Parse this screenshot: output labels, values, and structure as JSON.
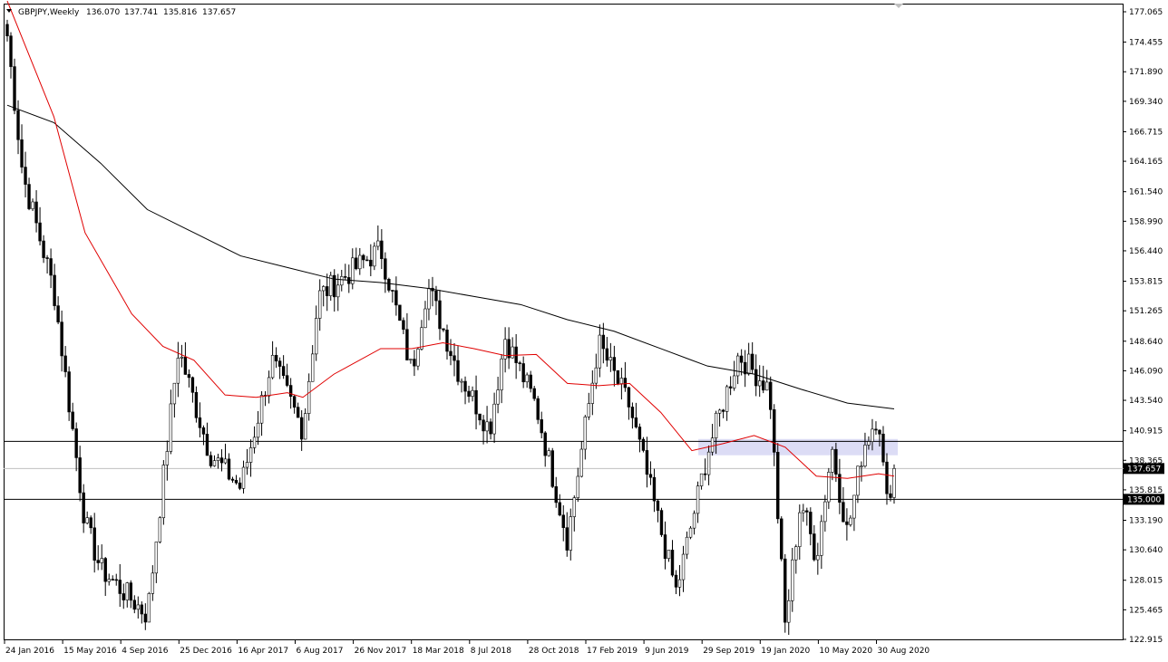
{
  "header": {
    "symbol": "GBPJPY,Weekly",
    "open": "136.070",
    "high": "137.741",
    "low": "135.816",
    "close": "137.657"
  },
  "price_axis": {
    "ticks": [
      "177.065",
      "174.455",
      "171.890",
      "169.340",
      "166.715",
      "164.165",
      "161.540",
      "158.990",
      "156.440",
      "153.815",
      "151.265",
      "148.640",
      "146.090",
      "143.540",
      "140.915",
      "138.365",
      "135.815",
      "133.190",
      "130.640",
      "128.015",
      "125.465",
      "122.915"
    ],
    "current_price_label": "137.657",
    "level_label": "135.000"
  },
  "time_axis": {
    "labels": [
      "24 Jan 2016",
      "15 May 2016",
      "4 Sep 2016",
      "25 Dec 2016",
      "16 Apr 2017",
      "6 Aug 2017",
      "26 Nov 2017",
      "18 Mar 2018",
      "8 Jul 2018",
      "28 Oct 2018",
      "17 Feb 2019",
      "9 Jun 2019",
      "29 Sep 2019",
      "19 Jan 2020",
      "10 May 2020",
      "30 Aug 2020"
    ]
  },
  "colors": {
    "background": "#ffffff",
    "axis": "#000000",
    "bull_candle": "#ffffff",
    "bear_candle": "#000000",
    "ma_fast": "#e00000",
    "ma_slow": "#000000",
    "zone": "#dcdcf5"
  },
  "chart_data": {
    "type": "candlestick",
    "instrument": "GBPJPY",
    "timeframe": "Weekly",
    "ylim": [
      122.915,
      177.065
    ],
    "x_range": [
      "24 Jan 2016",
      "Oct 2020"
    ],
    "grid": false,
    "horizontal_levels": [
      140.0,
      137.657,
      135.0
    ],
    "resistance_zone": [
      138.8,
      140.2
    ],
    "key_points": [
      {
        "date": "Jan 2016",
        "price": 175.0
      },
      {
        "date": "Feb 2016",
        "price": 163.0
      },
      {
        "date": "Apr 2016",
        "price": 153.0
      },
      {
        "date": "Jun 2016",
        "price": 133.0
      },
      {
        "date": "Jul 2016",
        "price": 129.0
      },
      {
        "date": "Oct 2016",
        "price": 125.0
      },
      {
        "date": "Dec 2016",
        "price": 148.0
      },
      {
        "date": "Feb 2017",
        "price": 139.0
      },
      {
        "date": "Apr 2017",
        "price": 136.0
      },
      {
        "date": "Jun 2017",
        "price": 147.0
      },
      {
        "date": "Aug 2017",
        "price": 141.0
      },
      {
        "date": "Sep 2017",
        "price": 152.5
      },
      {
        "date": "Jan 2018",
        "price": 156.6
      },
      {
        "date": "Mar 2018",
        "price": 146.0
      },
      {
        "date": "Apr 2018",
        "price": 153.5
      },
      {
        "date": "Jun 2018",
        "price": 146.0
      },
      {
        "date": "Aug 2018",
        "price": 141.0
      },
      {
        "date": "Sep 2018",
        "price": 149.0
      },
      {
        "date": "Nov 2018",
        "price": 143.0
      },
      {
        "date": "Jan 2019",
        "price": 131.5
      },
      {
        "date": "Mar 2019",
        "price": 148.5
      },
      {
        "date": "May 2019",
        "price": 143.0
      },
      {
        "date": "Aug 2019",
        "price": 127.0
      },
      {
        "date": "Oct 2019",
        "price": 139.0
      },
      {
        "date": "Dec 2019",
        "price": 147.5
      },
      {
        "date": "Feb 2020",
        "price": 144.5
      },
      {
        "date": "Mar 2020",
        "price": 124.0
      },
      {
        "date": "Apr 2020",
        "price": 135.0
      },
      {
        "date": "May 2020",
        "price": 130.0
      },
      {
        "date": "Jun 2020",
        "price": 139.5
      },
      {
        "date": "Jul 2020",
        "price": 132.0
      },
      {
        "date": "Aug 2020",
        "price": 139.5
      },
      {
        "date": "Sep 2020",
        "price": 142.5
      },
      {
        "date": "Sep 2020",
        "price": 134.5
      },
      {
        "date": "Oct 2020",
        "price": 137.657
      }
    ],
    "ma_fast": [
      {
        "date": "Jan 2016",
        "value": 178.0
      },
      {
        "date": "Apr 2016",
        "value": 168.0
      },
      {
        "date": "Jun 2016",
        "value": 158.0
      },
      {
        "date": "Sep 2016",
        "value": 151.0
      },
      {
        "date": "Nov 2016",
        "value": 148.2
      },
      {
        "date": "Jan 2017",
        "value": 147.0
      },
      {
        "date": "Mar 2017",
        "value": 144.0
      },
      {
        "date": "May 2017",
        "value": 143.8
      },
      {
        "date": "Jul 2017",
        "value": 144.2
      },
      {
        "date": "Aug 2017",
        "value": 143.8
      },
      {
        "date": "Oct 2017",
        "value": 145.8
      },
      {
        "date": "Jan 2018",
        "value": 148.0
      },
      {
        "date": "Mar 2018",
        "value": 148.0
      },
      {
        "date": "May 2018",
        "value": 148.5
      },
      {
        "date": "Jul 2018",
        "value": 148.0
      },
      {
        "date": "Sep 2018",
        "value": 147.4
      },
      {
        "date": "Nov 2018",
        "value": 147.5
      },
      {
        "date": "Jan 2019",
        "value": 145.0
      },
      {
        "date": "Mar 2019",
        "value": 144.8
      },
      {
        "date": "May 2019",
        "value": 145.0
      },
      {
        "date": "Jul 2019",
        "value": 142.5
      },
      {
        "date": "Sep 2019",
        "value": 139.2
      },
      {
        "date": "Nov 2019",
        "value": 139.8
      },
      {
        "date": "Jan 2020",
        "value": 140.5
      },
      {
        "date": "Mar 2020",
        "value": 139.5
      },
      {
        "date": "May 2020",
        "value": 137.0
      },
      {
        "date": "Jul 2020",
        "value": 136.8
      },
      {
        "date": "Sep 2020",
        "value": 137.2
      },
      {
        "date": "Oct 2020",
        "value": 137.0
      }
    ],
    "ma_slow": [
      {
        "date": "Jan 2016",
        "value": 169.0
      },
      {
        "date": "Apr 2016",
        "value": 167.5
      },
      {
        "date": "Jul 2016",
        "value": 164.0
      },
      {
        "date": "Oct 2016",
        "value": 160.0
      },
      {
        "date": "Jan 2017",
        "value": 158.0
      },
      {
        "date": "Apr 2017",
        "value": 156.0
      },
      {
        "date": "Jul 2017",
        "value": 155.0
      },
      {
        "date": "Oct 2017",
        "value": 154.0
      },
      {
        "date": "Jan 2018",
        "value": 153.7
      },
      {
        "date": "Apr 2018",
        "value": 153.2
      },
      {
        "date": "Jul 2018",
        "value": 152.5
      },
      {
        "date": "Oct 2018",
        "value": 151.8
      },
      {
        "date": "Jan 2019",
        "value": 150.5
      },
      {
        "date": "Apr 2019",
        "value": 149.5
      },
      {
        "date": "Jul 2019",
        "value": 148.0
      },
      {
        "date": "Oct 2019",
        "value": 146.5
      },
      {
        "date": "Jan 2020",
        "value": 145.8
      },
      {
        "date": "Apr 2020",
        "value": 144.5
      },
      {
        "date": "Jul 2020",
        "value": 143.3
      },
      {
        "date": "Oct 2020",
        "value": 142.8
      }
    ]
  }
}
